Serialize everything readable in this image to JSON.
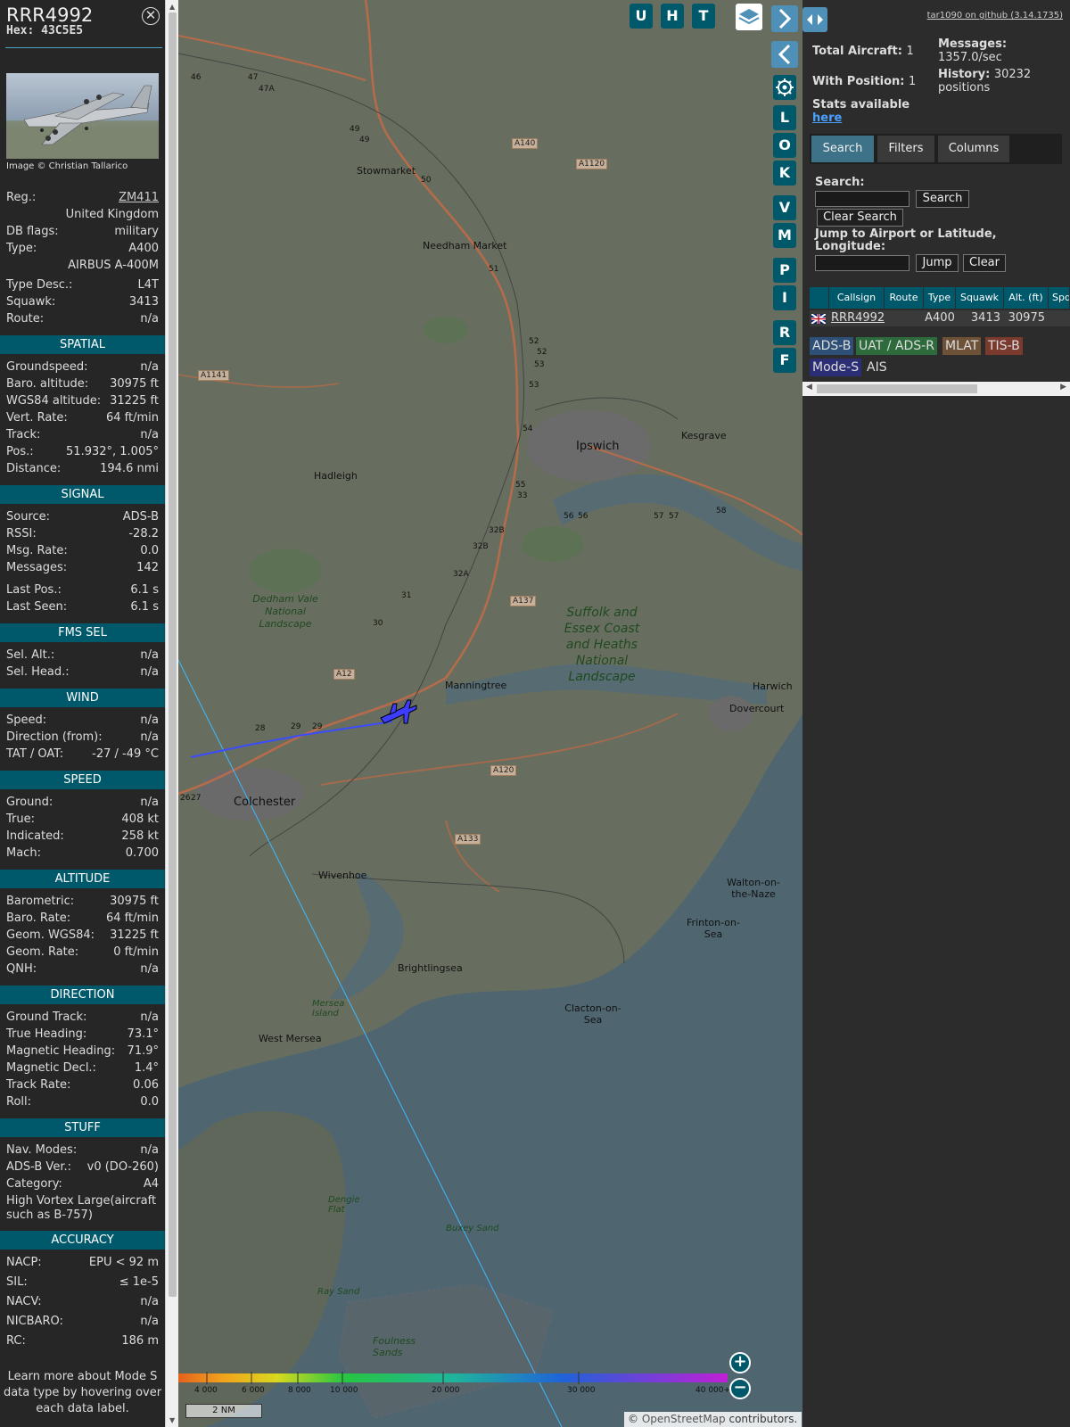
{
  "info": {
    "callsign": "RRR4992",
    "hex_line": "Hex: 43C5E5",
    "close_icon": "close-icon",
    "photo_credit": "Image © Christian Tallarico",
    "reg_label": "Reg.:",
    "reg_value": "ZM411",
    "country": "United Kingdom",
    "dbflags_label": "DB flags:",
    "dbflags_value": "military",
    "type_label": "Type:",
    "type_value": "A400",
    "type_full": "AIRBUS A-400M",
    "typedesc_label": "Type Desc.:",
    "typedesc_value": "L4T",
    "squawk_label": "Squawk:",
    "squawk_value": "3413",
    "route_label": "Route:",
    "route_value": "n/a",
    "sections": {
      "spatial": "SPATIAL",
      "signal": "SIGNAL",
      "fms": "FMS SEL",
      "wind": "WIND",
      "speed": "SPEED",
      "altitude": "ALTITUDE",
      "direction": "DIRECTION",
      "stuff": "STUFF",
      "accuracy": "ACCURACY"
    },
    "spatial": [
      {
        "label": "Groundspeed:",
        "value": "n/a"
      },
      {
        "label": "Baro. altitude:",
        "value": "30975 ft"
      },
      {
        "label": "WGS84 altitude:",
        "value": "31225 ft"
      },
      {
        "label": "Vert. Rate:",
        "value": "64 ft/min"
      },
      {
        "label": "Track:",
        "value": "n/a"
      },
      {
        "label": "Pos.:",
        "value": "51.932°, 1.005°"
      },
      {
        "label": "Distance:",
        "value": "194.6 nmi"
      }
    ],
    "signal": [
      {
        "label": "Source:",
        "value": "ADS-B"
      },
      {
        "label": "RSSI:",
        "value": "-28.2"
      },
      {
        "label": "Msg. Rate:",
        "value": "0.0"
      },
      {
        "label": "Messages:",
        "value": "142"
      },
      {
        "label": "Last Pos.:",
        "value": "6.1 s"
      },
      {
        "label": "Last Seen:",
        "value": "6.1 s"
      }
    ],
    "fms": [
      {
        "label": "Sel. Alt.:",
        "value": "n/a"
      },
      {
        "label": "Sel. Head.:",
        "value": "n/a"
      }
    ],
    "wind": [
      {
        "label": "Speed:",
        "value": "n/a"
      },
      {
        "label": "Direction (from):",
        "value": "n/a"
      },
      {
        "label": "TAT / OAT:",
        "value": "-27 / -49 °C"
      }
    ],
    "speed": [
      {
        "label": "Ground:",
        "value": "n/a"
      },
      {
        "label": "True:",
        "value": "408 kt"
      },
      {
        "label": "Indicated:",
        "value": "258 kt"
      },
      {
        "label": "Mach:",
        "value": "0.700"
      }
    ],
    "altitude": [
      {
        "label": "Barometric:",
        "value": "30975 ft"
      },
      {
        "label": "Baro. Rate:",
        "value": "64 ft/min"
      },
      {
        "label": "Geom. WGS84:",
        "value": "31225 ft"
      },
      {
        "label": "Geom. Rate:",
        "value": "0 ft/min"
      },
      {
        "label": "QNH:",
        "value": "n/a"
      }
    ],
    "direction": [
      {
        "label": "Ground Track:",
        "value": "n/a"
      },
      {
        "label": "True Heading:",
        "value": "73.1°"
      },
      {
        "label": "Magnetic Heading:",
        "value": "71.9°"
      },
      {
        "label": "Magnetic Decl.:",
        "value": "1.4°"
      },
      {
        "label": "Track Rate:",
        "value": "0.06"
      },
      {
        "label": "Roll:",
        "value": "0.0"
      }
    ],
    "stuff": [
      {
        "label": "Nav. Modes:",
        "value": "n/a"
      },
      {
        "label": "ADS-B Ver.:",
        "value": "v0 (DO-260)"
      },
      {
        "label": "Category:",
        "value": "A4"
      }
    ],
    "category_desc": "High Vortex Large(aircraft such as B-757)",
    "accuracy": [
      {
        "label": "NACP:",
        "value": "EPU < 92 m"
      },
      {
        "label": "SIL:",
        "value": "≤ 1e-5"
      },
      {
        "label": "NACV:",
        "value": "n/a"
      },
      {
        "label": "NICBARO:",
        "value": "n/a"
      },
      {
        "label": "RC:",
        "value": "186 m"
      }
    ],
    "learn_more": "Learn more about Mode S data type by hovering over each data label."
  },
  "map": {
    "buttons": {
      "u": "U",
      "h": "H",
      "t": "T",
      "l": "L",
      "o": "O",
      "k": "K",
      "v": "V",
      "m": "M",
      "p": "P",
      "i": "I",
      "r": "R",
      "f": "F"
    },
    "icons": {
      "layers": "layers-icon",
      "next": "chevron-right-icon",
      "prev": "chevron-left-icon",
      "expand": "expand-horizontal-icon",
      "settings": "gear-icon",
      "zoom_in": "plus-icon",
      "zoom_out": "minus-icon",
      "aircraft": "aircraft-icon"
    },
    "places": {
      "stowmarket": "Stowmarket",
      "needham": "Needham Market",
      "ipswich": "Ipswich",
      "kesgrave": "Kesgrave",
      "hadleigh": "Hadleigh",
      "dedham": "Dedham Vale National Landscape",
      "suffolk": "Suffolk and Essex Coast and Heaths National Landscape",
      "manningtree": "Manningtree",
      "harwich": "Harwich",
      "dovercourt": "Dovercourt",
      "colchester": "Colchester",
      "wivenhoe": "Wivenhoe",
      "walton": "Walton-on-the-Naze",
      "frinton": "Frinton-on-Sea",
      "brightlingsea": "Brightlingsea",
      "mersea": "Mersea Island",
      "westmersea": "West Mersea",
      "clacton": "Clacton-on-Sea",
      "dengie": "Dengie Flat",
      "buxey": "Buxey Sand",
      "raysand": "Ray Sand",
      "foulness": "Foulness Sands"
    },
    "roads": {
      "a140": "A140",
      "a1120": "A1120",
      "a1141": "A1141",
      "a137": "A137",
      "a12": "A12",
      "a120": "A120",
      "a133": "A133"
    },
    "junctions": [
      "46",
      "47",
      "47A",
      "49",
      "49",
      "50",
      "51",
      "52",
      "52",
      "53",
      "53",
      "54",
      "55",
      "33",
      "56",
      "56",
      "57",
      "57",
      "58",
      "32B",
      "32B",
      "32A",
      "31",
      "30",
      "28",
      "29",
      "29",
      "27",
      "26"
    ],
    "altitude_scale": [
      "4 000",
      "6 000",
      "8 000",
      "10 000",
      "20 000",
      "30 000",
      "40 000+"
    ],
    "scale": "2 NM",
    "attribution_prefix": "© ",
    "attribution_link": "OpenStreetMap",
    "attribution_suffix": " contributors."
  },
  "sidebar": {
    "github": "tar1090 on github (3.14.1735)",
    "total_label": "Total Aircraft:",
    "total_value": "1",
    "messages_label": "Messages:",
    "messages_value": "1357.0/sec",
    "withpos_label": "With Position:",
    "withpos_value": "1",
    "history_label": "History:",
    "history_value": "30232 positions",
    "stats_label": "Stats available",
    "stats_link": "here",
    "tabs": [
      "Search",
      "Filters",
      "Columns"
    ],
    "search_label": "Search:",
    "search_button": "Search",
    "clear_search": "Clear Search",
    "jump_label": "Jump to Airport or Latitude, Longitude:",
    "jump_button": "Jump",
    "clear_button": "Clear",
    "columns": [
      "Callsign",
      "Route",
      "Type",
      "Squawk",
      "Alt. (ft)",
      "Spd"
    ],
    "rows": [
      {
        "callsign": "RRR4992",
        "route": "",
        "type": "A400",
        "squawk": "3413",
        "alt": "30975"
      }
    ],
    "legend": [
      "ADS-B",
      "UAT / ADS-R",
      "MLAT",
      "TIS-B",
      "Mode-S",
      "AIS"
    ],
    "legend_colors": [
      "#2e5078",
      "#2d6b3c",
      "#6e5238",
      "#7a3a2e",
      "#2b2e75",
      "#2c2c2c"
    ]
  }
}
